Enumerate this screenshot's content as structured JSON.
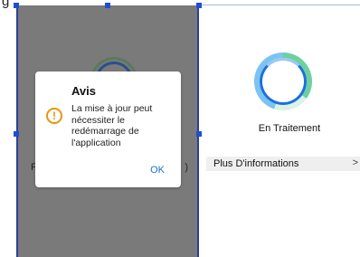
{
  "fragment": {
    "top_text": "g"
  },
  "left_screen": {
    "strip_label_fragment": "F",
    "strip_end_fragment": ")"
  },
  "right_screen": {
    "status": "En Traitement",
    "info_label": "Plus D'informations",
    "chevron": ">"
  },
  "dialog": {
    "title": "Avis",
    "message": "La mise à jour peut nécessiter le redémarrage de l'application",
    "ok": "OK",
    "icon": "warning-icon"
  },
  "colors": {
    "accent": "#1a73c8",
    "warning": "#e8950f",
    "selection": "#1f4fd1",
    "overlay": "#7a7a7a"
  }
}
